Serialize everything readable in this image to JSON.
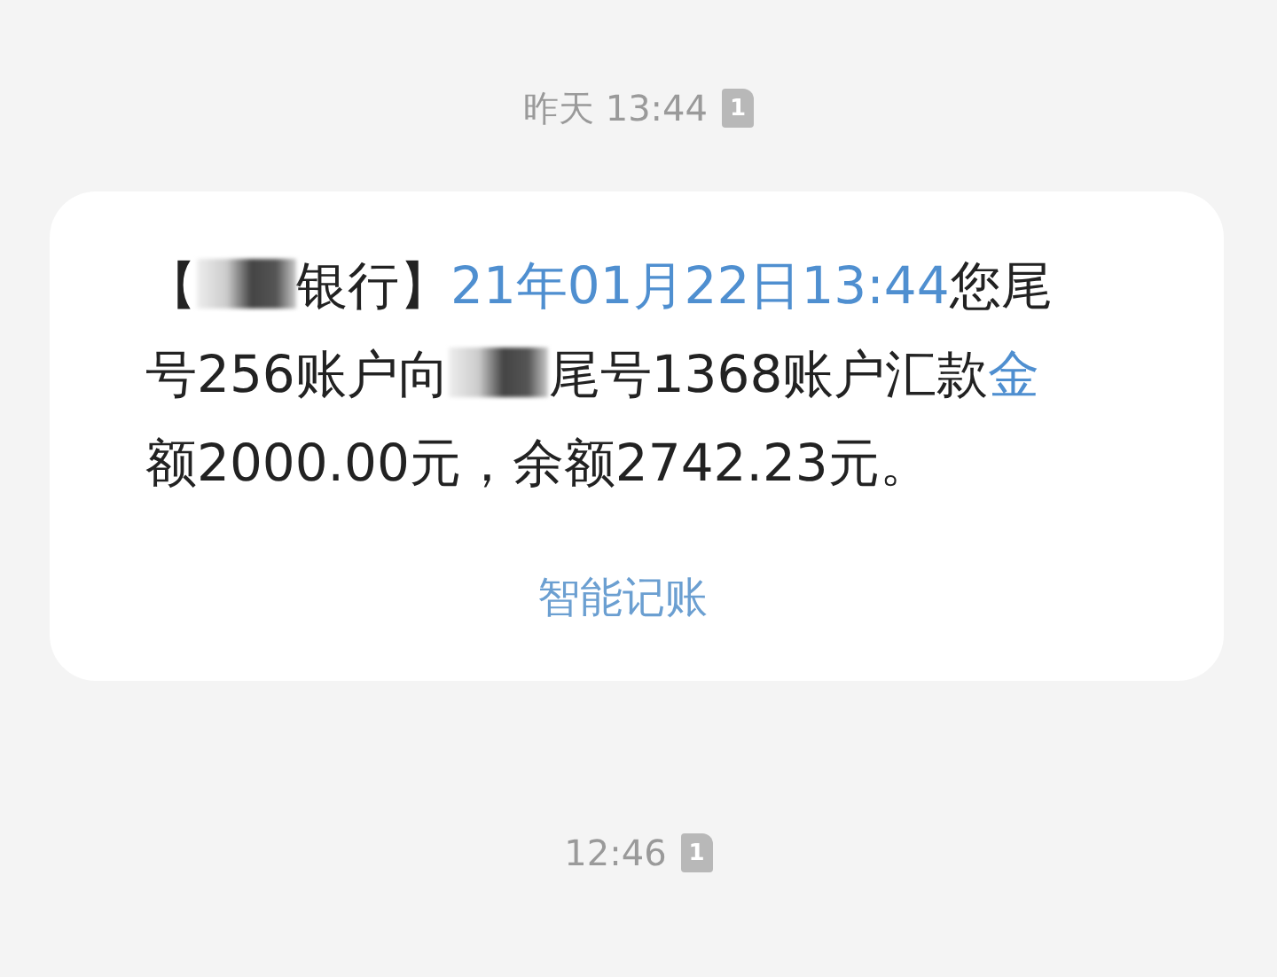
{
  "messages": [
    {
      "time": "昨天 13:44",
      "sim_slot": "1",
      "body": [
        {
          "kind": "text",
          "text": "【"
        },
        {
          "kind": "redaction"
        },
        {
          "kind": "text",
          "text": "银行】"
        },
        {
          "kind": "link",
          "text": "21年01月22日13:44"
        },
        {
          "kind": "text",
          "text": "您尾号256账户向"
        },
        {
          "kind": "redaction"
        },
        {
          "kind": "text",
          "text": "尾号1368账户汇款"
        },
        {
          "kind": "link",
          "text": "金"
        },
        {
          "kind": "text",
          "text": "额2000.00元，余额2742.23元。"
        }
      ],
      "action": "智能记账"
    },
    {
      "time": "12:46",
      "sim_slot": "1"
    }
  ]
}
